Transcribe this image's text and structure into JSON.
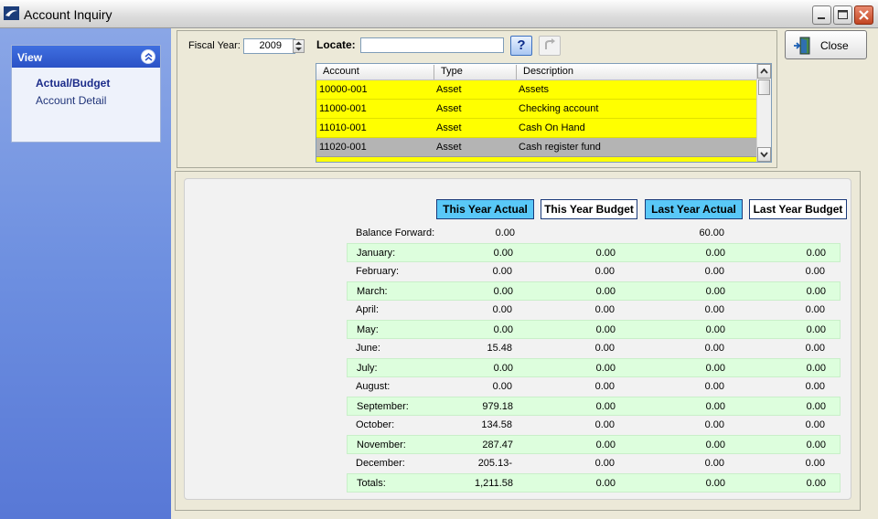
{
  "window": {
    "title": "Account Inquiry"
  },
  "sidebar": {
    "header": "View",
    "items": [
      {
        "label": "Actual/Budget",
        "active": true
      },
      {
        "label": "Account Detail",
        "active": false
      }
    ]
  },
  "filters": {
    "fiscal_year_label": "Fiscal Year:",
    "fiscal_year_value": "2009",
    "locate_label": "Locate:",
    "locate_value": "",
    "help_label": "?"
  },
  "accounts": {
    "headers": [
      "Account",
      "Type",
      "Description"
    ],
    "rows": [
      {
        "account": "10000-001",
        "type": "Asset",
        "description": "Assets",
        "selected": false
      },
      {
        "account": "11000-001",
        "type": "Asset",
        "description": "Checking account",
        "selected": false
      },
      {
        "account": "11010-001",
        "type": "Asset",
        "description": "Cash On Hand",
        "selected": false
      },
      {
        "account": "11020-001",
        "type": "Asset",
        "description": "Cash register fund",
        "selected": true
      }
    ]
  },
  "close_button": {
    "label": "Close"
  },
  "summary": {
    "columns": [
      {
        "label": "This Year Actual",
        "active": true
      },
      {
        "label": "This Year Budget",
        "active": false
      },
      {
        "label": "Last Year Actual",
        "active": true
      },
      {
        "label": "Last Year Budget",
        "active": false
      }
    ],
    "balance_forward": {
      "label": "Balance Forward:",
      "this_year_actual": "0.00",
      "last_year_actual": "60.00"
    },
    "months": [
      {
        "label": "January:",
        "values": [
          "0.00",
          "0.00",
          "0.00",
          "0.00"
        ]
      },
      {
        "label": "February:",
        "values": [
          "0.00",
          "0.00",
          "0.00",
          "0.00"
        ]
      },
      {
        "label": "March:",
        "values": [
          "0.00",
          "0.00",
          "0.00",
          "0.00"
        ]
      },
      {
        "label": "April:",
        "values": [
          "0.00",
          "0.00",
          "0.00",
          "0.00"
        ]
      },
      {
        "label": "May:",
        "values": [
          "0.00",
          "0.00",
          "0.00",
          "0.00"
        ]
      },
      {
        "label": "June:",
        "values": [
          "15.48",
          "0.00",
          "0.00",
          "0.00"
        ]
      },
      {
        "label": "July:",
        "values": [
          "0.00",
          "0.00",
          "0.00",
          "0.00"
        ]
      },
      {
        "label": "August:",
        "values": [
          "0.00",
          "0.00",
          "0.00",
          "0.00"
        ]
      },
      {
        "label": "September:",
        "values": [
          "979.18",
          "0.00",
          "0.00",
          "0.00"
        ]
      },
      {
        "label": "October:",
        "values": [
          "134.58",
          "0.00",
          "0.00",
          "0.00"
        ]
      },
      {
        "label": "November:",
        "values": [
          "287.47",
          "0.00",
          "0.00",
          "0.00"
        ]
      },
      {
        "label": "December:",
        "values": [
          "205.13-",
          "0.00",
          "0.00",
          "0.00"
        ]
      }
    ],
    "totals": {
      "label": "Totals:",
      "values": [
        "1,211.58",
        "0.00",
        "0.00",
        "0.00"
      ]
    }
  },
  "colors": {
    "row_highlight": "#ffff00",
    "row_selected": "#b4b4b4",
    "active_column": "#59c8f7",
    "alt_row": "#ddfedd",
    "sidebar_header": "#2b52c6"
  }
}
